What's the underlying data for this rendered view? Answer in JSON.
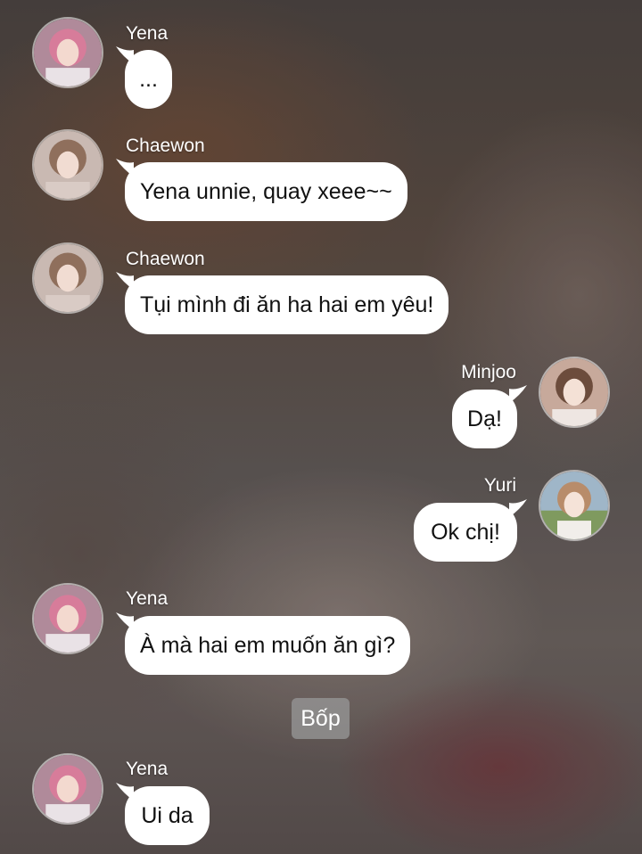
{
  "messages": [
    {
      "sender": "Yena",
      "text": "..."
    },
    {
      "sender": "Chaewon",
      "text": "Yena unnie, quay xeee~~"
    },
    {
      "sender": "Chaewon",
      "text": "Tụi mình đi ăn ha hai em yêu!"
    },
    {
      "sender": "Minjoo",
      "text": "Dạ!"
    },
    {
      "sender": "Yuri",
      "text": "Ok chị!"
    },
    {
      "sender": "Yena",
      "text": "À mà hai em muốn ăn gì?"
    },
    {
      "sender": "Yena",
      "text": "Ui da"
    }
  ],
  "notice": {
    "text": "Bốp"
  },
  "colors": {
    "bubble": "#ffffff",
    "notice": "#969696",
    "name": "#ffffff"
  }
}
